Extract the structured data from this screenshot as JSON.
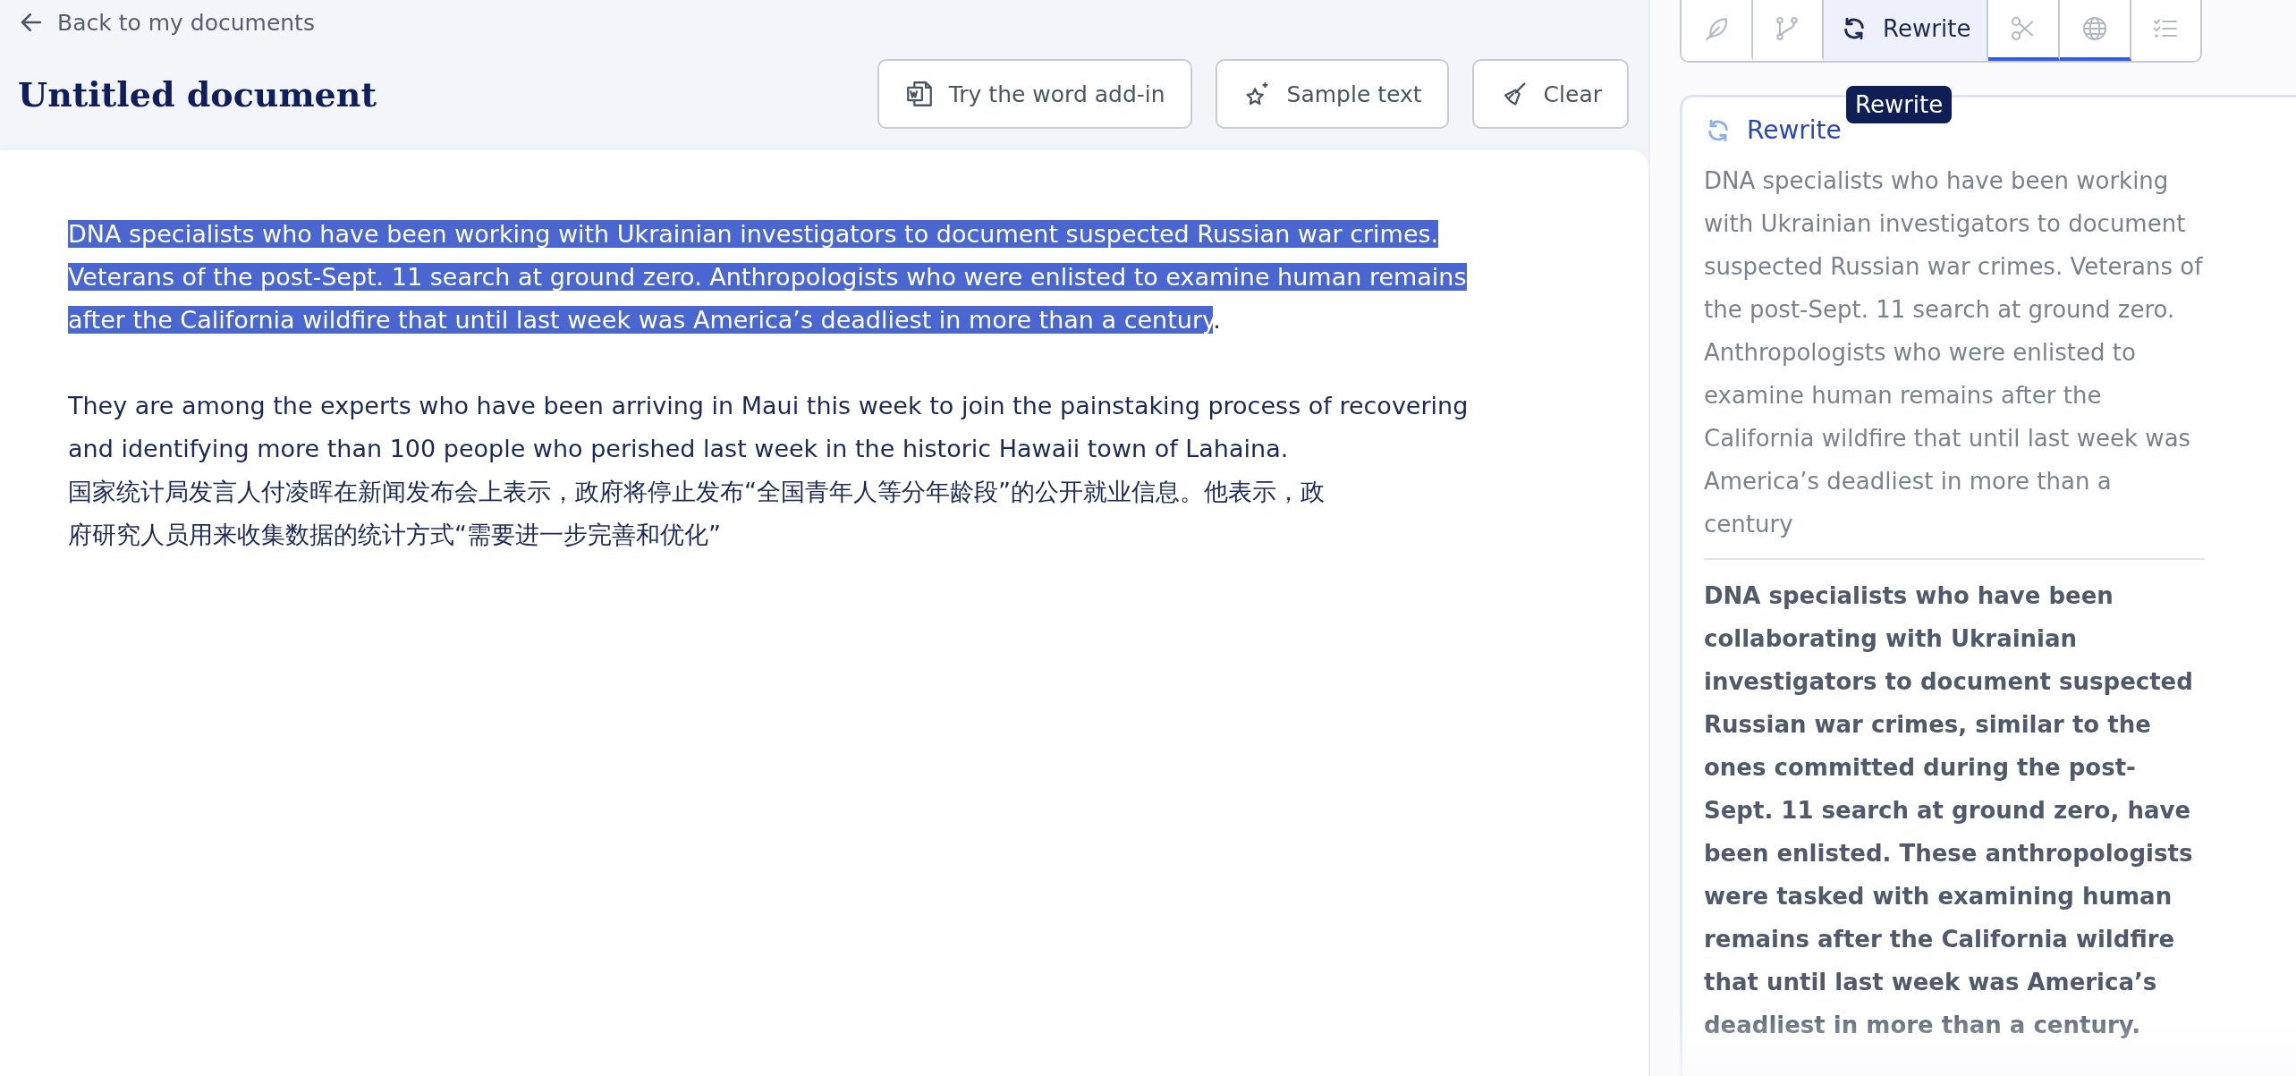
{
  "back_link": "Back to my documents",
  "document_title": "Untitled document",
  "actions": [
    {
      "kind": "word",
      "label": "Try the word add-in"
    },
    {
      "kind": "sparkle",
      "label": "Sample text"
    },
    {
      "kind": "broom",
      "label": "Clear"
    }
  ],
  "paragraphs": [
    {
      "lines": [
        {
          "segments": [
            {
              "text": "DNA specialists who have been working with Ukrainian investigators to document suspected Russian war crimes.",
              "highlighted": true
            }
          ]
        },
        {
          "segments": [
            {
              "text": "Veterans of the post-Sept. 11 search at ground zero. Anthropologists who were enlisted to examine human remains",
              "highlighted": true
            }
          ]
        },
        {
          "segments": [
            {
              "text": "after the California wildfire that until last week was America’s deadliest in more than a century",
              "highlighted": true
            },
            {
              "text": ".",
              "highlighted": false
            }
          ]
        }
      ]
    },
    {
      "lines": [
        {
          "segments": [
            {
              "text": "They are among the experts who have been arriving in Maui this week to join the painstaking process of recovering",
              "highlighted": false
            }
          ]
        },
        {
          "segments": [
            {
              "text": "and identifying more than 100 people who perished last week in the historic Hawaii town of Lahaina.",
              "highlighted": false
            }
          ]
        },
        {
          "segments": [
            {
              "text": "国家统计局发言人付凌晖在新闻发布会上表示，政府将停止发布“全国青年人等分年龄段”的公开就业信息。他表示，政",
              "highlighted": false
            }
          ]
        },
        {
          "segments": [
            {
              "text": "府研究人员用来收集数据的统计方式“需要进一步完善和优化”",
              "highlighted": false
            }
          ]
        }
      ]
    }
  ],
  "tools": [
    {
      "kind": "feather",
      "selected": false,
      "underlined": false
    },
    {
      "kind": "branch",
      "selected": false,
      "underlined": false
    },
    {
      "kind": "rewrite",
      "label": "Rewrite",
      "selected": true,
      "underlined": false
    },
    {
      "kind": "scissors",
      "selected": false,
      "underlined": true
    },
    {
      "kind": "globe",
      "selected": false,
      "underlined": true
    },
    {
      "kind": "checklist",
      "selected": false,
      "underlined": false
    }
  ],
  "tooltip": "Rewrite",
  "panel": {
    "title": "Rewrite",
    "original": "DNA specialists who have been working with Ukrainian investigators to document suspected Russian war crimes. Veterans of the post-Sept. 11 search at ground zero. Anthropologists who were enlisted to examine human remains after the California wildfire that until last week was America’s deadliest in more than a century",
    "suggestion": "DNA specialists who have been collaborating with Ukrainian investigators to document suspected Russian war crimes, similar to the ones committed during the post-Sept. 11 search at ground zero, have been enlisted. These anthropologists were tasked with examining human remains after the California wildfire that until last week was America’s deadliest in more than a century."
  }
}
